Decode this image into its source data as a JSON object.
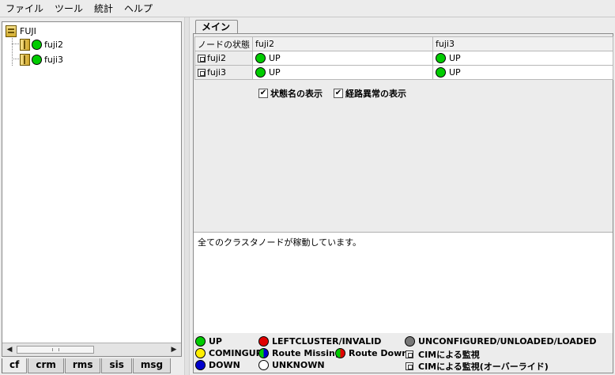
{
  "menubar": {
    "items": [
      "ファイル",
      "ツール",
      "統計",
      "ヘルプ"
    ]
  },
  "tree": {
    "cluster": "FUJI",
    "nodes": [
      {
        "name": "fuji2",
        "status": "UP"
      },
      {
        "name": "fuji3",
        "status": "UP"
      }
    ]
  },
  "bottom_tabs": [
    "cf",
    "crm",
    "rms",
    "sis",
    "msg"
  ],
  "main_tab": "メイン",
  "status_table": {
    "corner": "ノードの状態",
    "columns": [
      "fuji2",
      "fuji3"
    ],
    "rows": [
      {
        "node": "fuji2",
        "cells": [
          "UP",
          "UP"
        ]
      },
      {
        "node": "fuji3",
        "cells": [
          "UP",
          "UP"
        ]
      }
    ]
  },
  "options": {
    "show_state_names": "状態名の表示",
    "show_route_errors": "経路異常の表示"
  },
  "message": "全てのクラスタノードが稼動しています。",
  "legend": {
    "up": "UP",
    "leftcluster": "LEFTCLUSTER/INVALID",
    "unconfigured": "UNCONFIGURED/UNLOADED/LOADED",
    "comingup": "COMINGUP",
    "route_missing": "Route Missing",
    "route_down": "Route Down",
    "cim": "CIMによる監視",
    "down": "DOWN",
    "unknown": "UNKNOWN",
    "cim_override": "CIMによる監視(オーバーライド)"
  },
  "colors": {
    "up": "#00cc00",
    "down": "#0000cc",
    "leftcluster": "#e00000",
    "comingup": "#ffee00",
    "unknown": "#ffffff",
    "unconfigured": "#777777"
  }
}
